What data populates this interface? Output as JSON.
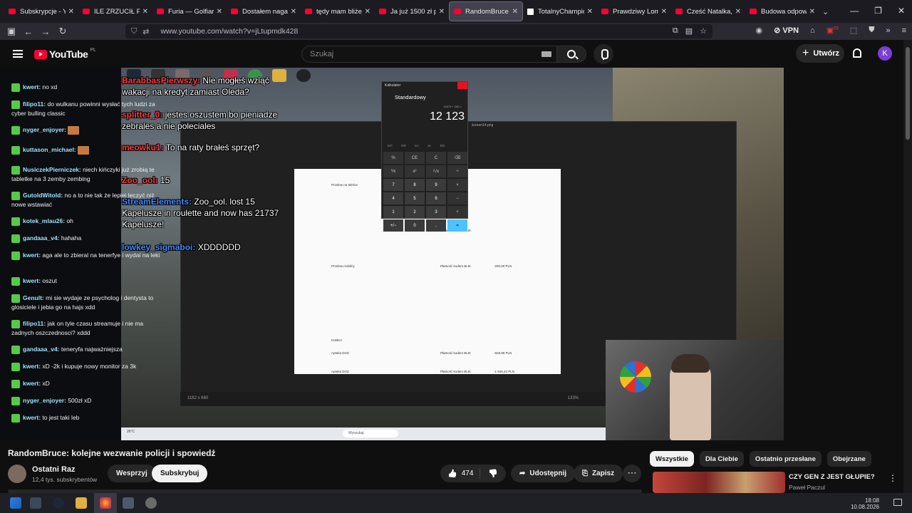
{
  "tabs": [
    {
      "title": "Subskrypcje - YouTube",
      "icon": "youtube-icon"
    },
    {
      "title": "ILE ZRZUCIŁ PO P",
      "icon": "youtube-icon"
    },
    {
      "title": "Furia — Golfiarze",
      "icon": "youtube-icon"
    },
    {
      "title": "Dostałem naganę",
      "icon": "youtube-icon"
    },
    {
      "title": "tędy mam bliżej -",
      "icon": "youtube-icon"
    },
    {
      "title": "Ja już 1500 zł płac",
      "icon": "youtube-icon"
    },
    {
      "title": "RandomBruce",
      "icon": "youtube-icon",
      "active": true
    },
    {
      "title": "TotalnyChampion",
      "icon": "x-icon"
    },
    {
      "title": "Prawdziwy Lombar",
      "icon": "youtube-icon"
    },
    {
      "title": "Cześć Natalka, mo",
      "icon": "youtube-icon"
    },
    {
      "title": "Budowa odpowiad",
      "icon": "youtube-icon"
    }
  ],
  "browser": {
    "url": "www.youtube.com/watch?v=jLtupmdk428",
    "vpn_label": "VPN",
    "ext_badge": "55"
  },
  "youtube": {
    "logo": "YouTube",
    "region": "PL",
    "search_placeholder": "Szukaj",
    "create_label": "Utwórz",
    "avatar_letter": "K"
  },
  "chat": [
    {
      "user": "kwert:",
      "text": "no xd"
    },
    {
      "user": "filipo11:",
      "text": "do wulkanu powinni wysłać tych ludzi za cyber bulling classic"
    },
    {
      "user": "nyger_enjoyer:",
      "text": ""
    },
    {
      "user": "kuttason_michael:",
      "text": ""
    },
    {
      "user": "NusiczekPierniczek:",
      "text": "niech kińczyki już zrobią te tabletke na 3 zemby zembing"
    },
    {
      "user": "GutoldWitold:",
      "text": "no a to nie tak że lepiej leczyć niż nowe wstawiać"
    },
    {
      "user": "kotek_mlau26:",
      "text": "oh"
    },
    {
      "user": "gandaaa_v4:",
      "text": "hahaha"
    },
    {
      "user": "kwert:",
      "text": "aga ale to zbieral na tenerfye i wydal na leki"
    },
    {
      "user": "kwert:",
      "text": "oszut"
    },
    {
      "user": "Genult:",
      "text": "mi sie wydaje ze psycholog i dentysta to glosiciele i jebia go na hajs xdd"
    },
    {
      "user": "filipo11:",
      "text": "jak on tyle czasu streamuje i nie ma zadnych oszczednosci? xddd"
    },
    {
      "user": "gandaaa_v4:",
      "text": "teneryfa najważniejsza"
    },
    {
      "user": "kwert:",
      "text": "xD -2k i kupuje nowy monitor za 3k"
    },
    {
      "user": "kwert:",
      "text": "xD"
    },
    {
      "user": "nyger_enjoyer:",
      "text": "500zł xD"
    },
    {
      "user": "kwert:",
      "text": "to jest taki leb"
    }
  ],
  "overlay_chat": [
    {
      "user": "BarabbasPierwszy:",
      "text": "Nie mogłeś wziąć wakacji na kredyt zamiast Oleda?",
      "color": "red"
    },
    {
      "user": "splitter_0:",
      "text": "jestes oszustem bo pieniadze zebrales a nie poleciales",
      "color": "red"
    },
    {
      "user": "meowku1:",
      "text": "To na raty brałeś sprzęt?",
      "color": "red"
    },
    {
      "user": "Zoo_ool:",
      "text": "15",
      "color": "red"
    },
    {
      "user": "StreamElements:",
      "text": "Zoo_ool. lost 15 Kapelusze in roulette and now has 21737 Kapelusze!",
      "color": "blue"
    },
    {
      "user": "lowkey_sigmaboi:",
      "text": "XDDDDDD",
      "color": "blue"
    }
  ],
  "calculator": {
    "title": "Kalkulator",
    "mode": "Standardowy",
    "expression": "11673 + 250 =",
    "display": "12 123",
    "memory": [
      "MC",
      "MR",
      "M+",
      "M-",
      "MS"
    ],
    "keys": [
      "%",
      "CE",
      "C",
      "⌫",
      "⅟x",
      "x²",
      "²√x",
      "÷",
      "7",
      "8",
      "9",
      "×",
      "4",
      "5",
      "6",
      "−",
      "1",
      "2",
      "3",
      "+",
      "+/−",
      "0",
      ",",
      "="
    ]
  },
  "screenshot": {
    "title": "ścreen14.png",
    "rows": [
      {
        "label": "Przelew na telefon",
        "right": "",
        "amount": ""
      },
      {
        "label": "",
        "right": "Płatność kodem BLIK",
        "amount": ""
      },
      {
        "label": "Przelew mobilny",
        "right": "Płatność kodem BLIK",
        "amount": "-200,00 PLN"
      },
      {
        "label": "KUBKA",
        "right": "",
        "amount": ""
      },
      {
        "label": "Apteka DOZ",
        "right": "Płatność kodem BLIK",
        "amount": "-928,99 PLN"
      },
      {
        "label": "Apteka DOZ",
        "right": "Płatność kodem BLIK",
        "amount": "-1 846,42 PLN"
      }
    ],
    "status": "1162 x 660",
    "zoom": "133%"
  },
  "video_taskbar": {
    "weather": "26°C",
    "search": "Wyszukaj"
  },
  "video": {
    "title": "RandomBruce: kolejne wezwanie policji i spowiedź",
    "channel": "Ostatni Raz",
    "subscribers": "12,4 tys. subskrybentów",
    "join_label": "Wesprzyj",
    "subscribe_label": "Subskrybuj",
    "likes": "474",
    "share_label": "Udostępnij",
    "save_label": "Zapisz"
  },
  "sidebar_chips": [
    "Wszystkie",
    "Dla Ciebie",
    "Ostatnio przesłane",
    "Obejrzane"
  ],
  "recommendation": {
    "title": "CZY GEN Z JEST GŁUPIE?",
    "channel": "Paweł Paczul"
  },
  "system": {
    "time": "18:08",
    "date": "10.08.2026"
  }
}
